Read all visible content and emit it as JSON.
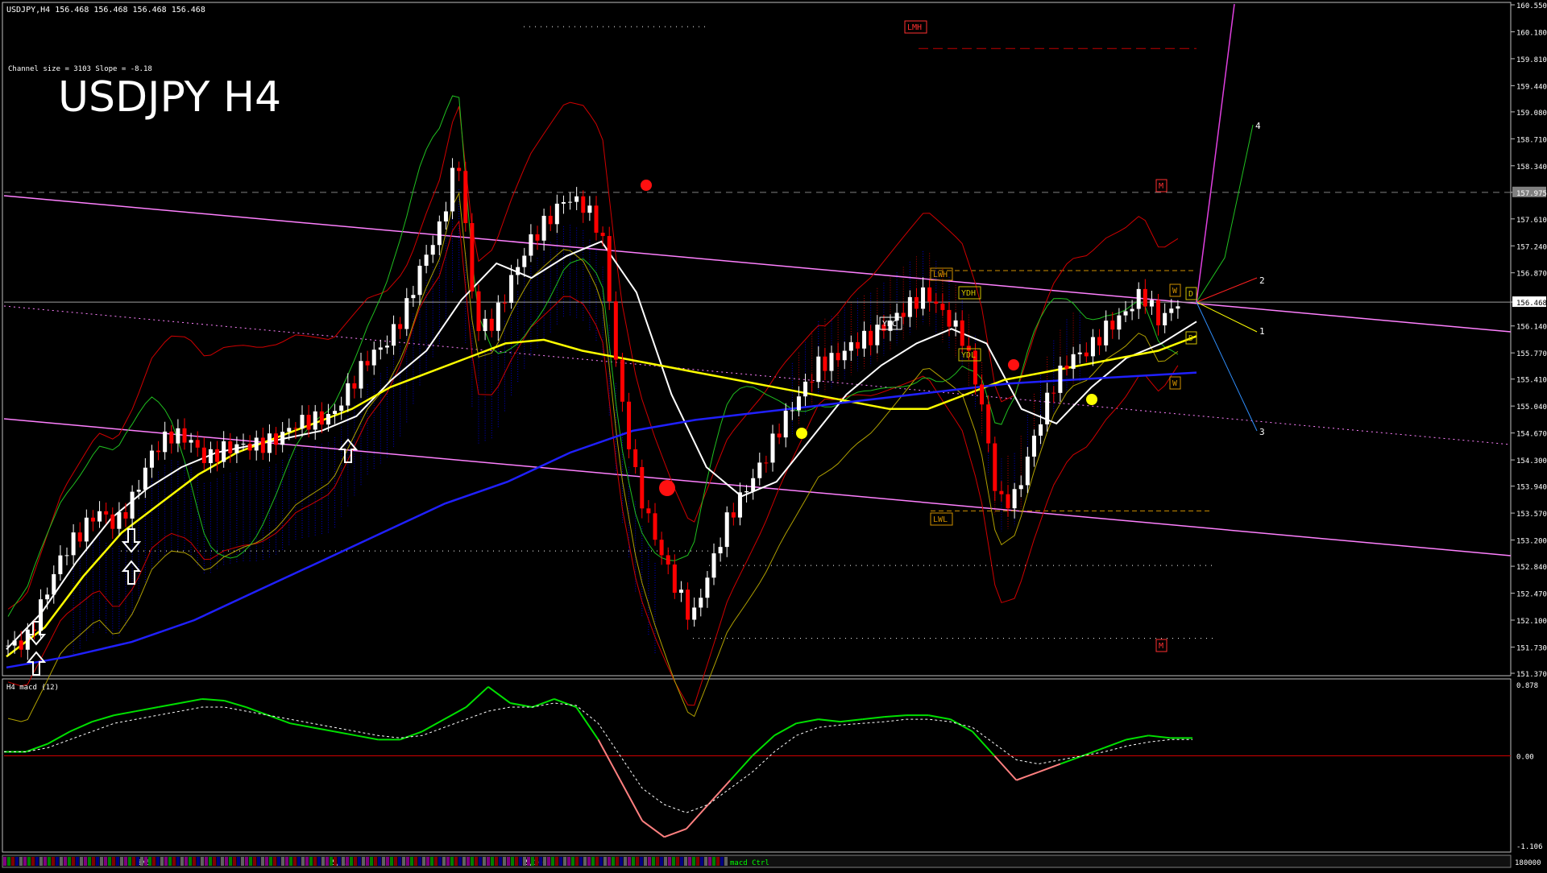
{
  "header": {
    "info": "USDJPY,H4  156.468 156.468 156.468 156.468",
    "channel_info": "Channel size = 3103 Slope = -8.18",
    "big_title": "USDJPY H4"
  },
  "chart_data": [
    {
      "type": "candlestick",
      "title": "USDJPY H4",
      "symbol": "USDJPY",
      "timeframe": "H4",
      "ylim": [
        151.37,
        160.55
      ],
      "y_ticks": [
        160.55,
        160.18,
        159.81,
        159.44,
        159.08,
        158.71,
        158.34,
        157.975,
        157.61,
        157.24,
        156.87,
        156.468,
        156.14,
        155.77,
        155.41,
        155.04,
        154.67,
        154.3,
        153.94,
        153.57,
        153.2,
        152.84,
        152.47,
        152.1,
        151.73,
        151.37
      ],
      "y_tick_labels": [
        "160.550",
        "160.180",
        "159.810",
        "159.440",
        "159.080",
        "158.710",
        "158.340",
        "157.975",
        "157.610",
        "157.240",
        "156.870",
        "156.468",
        "156.140",
        "155.770",
        "155.410",
        "155.040",
        "154.670",
        "154.300",
        "153.940",
        "153.570",
        "153.200",
        "152.840",
        "152.470",
        "152.100",
        "151.730",
        "151.370"
      ],
      "x_tick_labels": [
        "5/6",
        "5/13",
        "5/20"
      ],
      "current_price": 156.468,
      "marked_level": 157.975,
      "bar_count": 180,
      "series": [
        {
          "name": "price_path",
          "values": [
            151.75,
            151.8,
            152.4,
            153.0,
            153.3,
            153.6,
            153.4,
            153.8,
            154.4,
            154.65,
            154.6,
            154.3,
            154.45,
            154.5,
            154.5,
            154.6,
            154.8,
            154.85,
            154.9,
            155.3,
            155.7,
            155.9,
            156.3,
            157.0,
            157.5,
            158.5,
            156.1,
            156.2,
            156.8,
            157.3,
            157.6,
            157.9,
            157.8,
            157.4,
            155.2,
            153.9,
            153.2,
            152.6,
            152.1,
            152.8,
            153.5,
            153.9,
            154.3,
            154.8,
            155.2,
            155.6,
            155.7,
            155.9,
            156.0,
            156.2,
            156.4,
            156.6,
            156.3,
            156.0,
            155.2,
            153.7,
            153.8,
            154.6,
            155.3,
            155.7,
            155.8,
            156.1,
            156.3,
            156.6,
            156.2,
            156.468
          ]
        },
        {
          "name": "",
          "values": [
            151.7,
            152.2,
            152.9,
            153.5,
            153.9,
            154.2,
            154.4,
            154.5,
            154.6,
            154.7,
            154.9,
            155.4,
            155.8,
            156.5,
            157.0,
            156.8,
            157.1,
            157.3,
            156.6,
            155.2,
            154.2,
            153.8,
            154.0,
            154.6,
            155.2,
            155.6,
            155.9,
            156.1,
            155.9,
            155.0,
            154.8,
            155.3,
            155.7,
            155.9,
            156.2
          ]
        },
        {
          "name": "",
          "values": [
            151.6,
            152.0,
            152.7,
            153.3,
            153.7,
            154.1,
            154.4,
            154.6,
            154.8,
            155.0,
            155.3,
            155.5,
            155.7,
            155.9,
            155.95,
            155.8,
            155.7,
            155.6,
            155.5,
            155.4,
            155.3,
            155.2,
            155.1,
            155.0,
            155.0,
            155.2,
            155.4,
            155.5,
            155.6,
            155.7,
            155.8,
            156.0
          ]
        },
        {
          "name": "",
          "values": [
            151.45,
            151.6,
            151.8,
            152.1,
            152.5,
            152.9,
            153.3,
            153.7,
            154.0,
            154.4,
            154.7,
            154.85,
            154.95,
            155.05,
            155.15,
            155.25,
            155.35,
            155.4,
            155.45,
            155.5
          ]
        }
      ],
      "labels": [
        "LMH",
        "M",
        "LWH",
        "YDH",
        "YDC",
        "YDL",
        "LWL",
        "W",
        "D",
        "M",
        "1",
        "2",
        "3",
        "4"
      ]
    },
    {
      "type": "line",
      "title": "H4  macd (12)",
      "ylim": [
        -1.106,
        0.878
      ],
      "y_tick_labels": [
        "0.878",
        "0.00",
        "-1.106"
      ],
      "series": [
        {
          "name": "",
          "values": [
            0.05,
            0.05,
            0.15,
            0.3,
            0.42,
            0.5,
            0.55,
            0.6,
            0.65,
            0.7,
            0.68,
            0.6,
            0.5,
            0.4,
            0.35,
            0.3,
            0.25,
            0.2,
            0.2,
            0.3,
            0.45,
            0.6,
            0.85,
            0.65,
            0.6,
            0.7,
            0.6,
            0.2,
            -0.3,
            -0.8,
            -1.0,
            -0.9,
            -0.6,
            -0.3,
            0.0,
            0.25,
            0.4,
            0.45,
            0.42,
            0.45,
            0.48,
            0.5,
            0.5,
            0.45,
            0.3,
            0.0,
            -0.3,
            -0.2,
            -0.1,
            0.0,
            0.1,
            0.2,
            0.25,
            0.22,
            0.22
          ]
        },
        {
          "name": "",
          "values": [
            0.05,
            0.05,
            0.1,
            0.2,
            0.3,
            0.4,
            0.45,
            0.5,
            0.55,
            0.6,
            0.6,
            0.55,
            0.5,
            0.45,
            0.4,
            0.35,
            0.3,
            0.25,
            0.22,
            0.25,
            0.35,
            0.45,
            0.55,
            0.6,
            0.6,
            0.65,
            0.62,
            0.4,
            0.0,
            -0.4,
            -0.6,
            -0.7,
            -0.6,
            -0.4,
            -0.2,
            0.05,
            0.25,
            0.35,
            0.38,
            0.4,
            0.42,
            0.45,
            0.45,
            0.42,
            0.35,
            0.15,
            -0.05,
            -0.1,
            -0.05,
            0.0,
            0.05,
            0.12,
            0.17,
            0.2,
            0.2
          ]
        }
      ]
    }
  ],
  "bottom_bar": {
    "label": "macd Ctrl",
    "bottom_right_value": "180000"
  },
  "colors": {
    "background": "#000000",
    "grid_border": "#c0c0c0",
    "magenta_channel": "#ff80ff",
    "ma_white": "#ffffff",
    "ma_yellow": "#ffff00",
    "ma_blue": "#2020ff",
    "bollinger_red": "#d00000",
    "green_oscillator": "#20c020",
    "ichimoku_cloud": "#0000cc",
    "candle_up": "#ffffff",
    "candle_down": "#ff0000",
    "macd_green": "#00e000",
    "macd_pink": "#ff8080",
    "zero_line": "#d00000"
  }
}
